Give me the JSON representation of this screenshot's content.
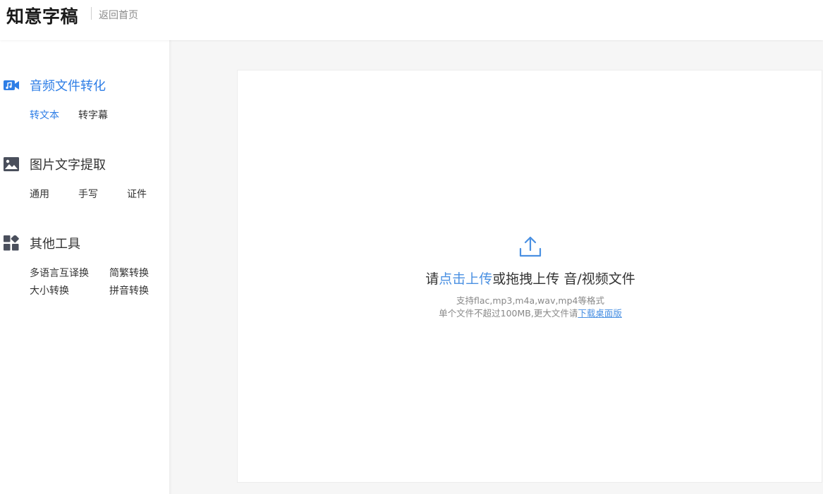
{
  "header": {
    "brand": "知意字稿",
    "back_link": "返回首页"
  },
  "sidebar": {
    "groups": [
      {
        "icon": "video-music-icon",
        "title": "音频文件转化",
        "active": true,
        "items": [
          "转文本",
          "转字幕"
        ]
      },
      {
        "icon": "image-icon",
        "title": "图片文字提取",
        "active": false,
        "items": [
          "通用",
          "手写",
          "证件"
        ]
      },
      {
        "icon": "grid-tools-icon",
        "title": "其他工具",
        "active": false,
        "items": [
          "多语言互译换",
          "简繁转换",
          "大小转换",
          "拼音转换"
        ]
      }
    ]
  },
  "upload": {
    "prefix": "请",
    "click_link": "点击上传",
    "middle": "或拖拽上传 音/视频文件",
    "hint_formats": "支持flac,mp3,m4a,wav,mp4等格式",
    "hint_limit": "单个文件不超过100MB,更大文件请",
    "download_link": "下载桌面版"
  },
  "colors": {
    "accent": "#2e7ee6",
    "link": "#4a90e2",
    "icon_gray": "#4a4f5c",
    "background": "#f6f6f6"
  }
}
